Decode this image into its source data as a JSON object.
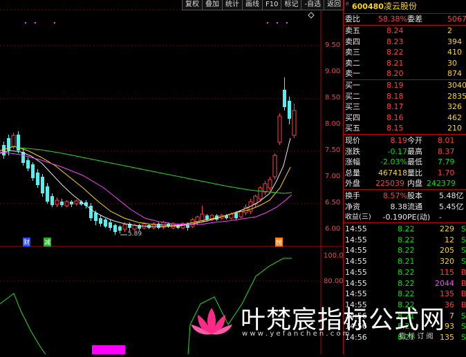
{
  "toolbar": {
    "buttons": [
      "复权",
      "叠加",
      "统计",
      "画线",
      "F10",
      "标记",
      "-自选",
      "返回"
    ]
  },
  "main_axis": {
    "price_ticks": [
      "9.50",
      "9.00",
      "8.50",
      "8.00",
      "7.50",
      "7.00",
      "6.50",
      "6.00"
    ],
    "min_marker": "5.89",
    "sub_ticks": [
      "100.0",
      "80.00"
    ]
  },
  "chart_markers": {
    "marker_1": "财",
    "marker_2": "减",
    "marker_3": "榜"
  },
  "stock": {
    "code_prefix": "R",
    "code": "600480",
    "name": "凌云股份"
  },
  "order_book": {
    "ratio_label": "委比",
    "ratio_value": "58.38%",
    "diff_label": "委差",
    "diff_value": "5067",
    "asks": [
      {
        "label": "卖五",
        "price": "8.24",
        "vol": "2"
      },
      {
        "label": "卖四",
        "price": "8.23",
        "vol": "394"
      },
      {
        "label": "卖三",
        "price": "8.22",
        "vol": "410"
      },
      {
        "label": "卖二",
        "price": "8.21",
        "vol": "30"
      },
      {
        "label": "卖一",
        "price": "8.20",
        "vol": "874"
      }
    ],
    "bids": [
      {
        "label": "买一",
        "price": "8.19",
        "vol": "3040"
      },
      {
        "label": "买二",
        "price": "8.18",
        "vol": "2835"
      },
      {
        "label": "买三",
        "price": "8.17",
        "vol": "326"
      },
      {
        "label": "买四",
        "price": "8.16",
        "vol": "462"
      },
      {
        "label": "买五",
        "price": "8.15",
        "vol": "210"
      }
    ]
  },
  "quote": {
    "rows": [
      {
        "l1": "现价",
        "v1": "8.19",
        "l2": "今开",
        "v2": "8.01"
      },
      {
        "l1": "涨跌",
        "v1": "-0.17",
        "l2": "最高",
        "v2": "8.37"
      },
      {
        "l1": "涨幅",
        "v1": "-2.03%",
        "l2": "最低",
        "v2": "7.79"
      },
      {
        "l1": "总量",
        "v1": "467418",
        "l2": "量比",
        "v2": "1.70"
      },
      {
        "l1": "外盘",
        "v1": "225039",
        "l2": "内盘",
        "v2": "242379"
      }
    ],
    "rows2": [
      {
        "l1": "换手",
        "v1": "8.57%",
        "l2": "股本",
        "v2": "5.48亿"
      },
      {
        "l1": "净资",
        "v1": "8.38",
        "l2": "流通",
        "v2": "5.45亿"
      },
      {
        "l1": "收益(三)",
        "v1": "-0.190",
        "l2": "PE(动)",
        "v2": "-"
      }
    ]
  },
  "trades": [
    {
      "time": "14:55",
      "price": "8.22",
      "vol": "229",
      "side": "S"
    },
    {
      "time": "14:55",
      "price": "8.22",
      "vol": "12",
      "side": "S"
    },
    {
      "time": "14:55",
      "price": "8.22",
      "vol": "205",
      "side": "S"
    },
    {
      "time": "14:55",
      "price": "8.21",
      "vol": "320",
      "side": "S"
    },
    {
      "time": "14:55",
      "price": "8.22",
      "vol": "115",
      "side": "B"
    },
    {
      "time": "14:55",
      "price": "8.22",
      "vol": "2044",
      "side": "B"
    },
    {
      "time": "14:55",
      "price": "8.22",
      "vol": "135",
      "side": "B"
    },
    {
      "time": "14:55",
      "price": "8.22",
      "vol": "36",
      "side": "B"
    },
    {
      "time": "14:56",
      "price": "8.21",
      "vol": "7",
      "side": "S"
    },
    {
      "time": "14:56",
      "price": "8.21",
      "vol": "93",
      "side": "S"
    },
    {
      "time": "14:56",
      "price": "8.21",
      "vol": "135",
      "side": "S"
    }
  ],
  "watermark": {
    "title": "叶梵宸指标公式网",
    "url": "w w w . y e f a n c h e n . c o m",
    "subtitle": "指 标 订 阅"
  }
}
